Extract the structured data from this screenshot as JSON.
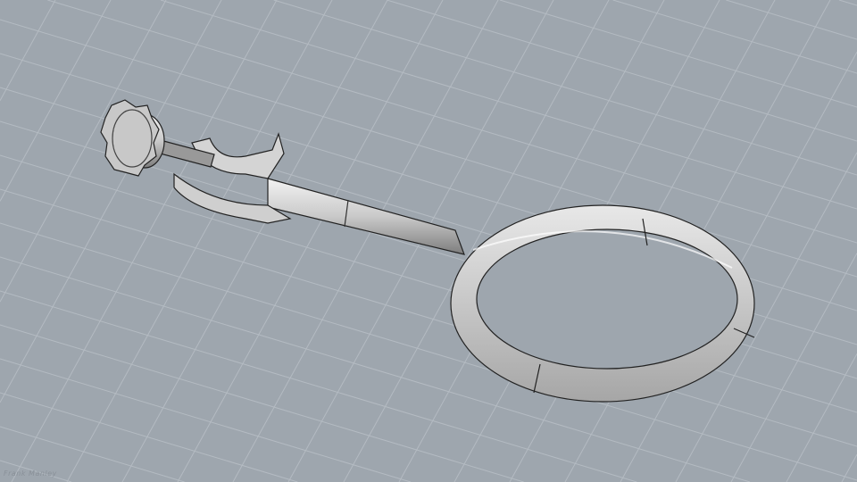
{
  "viewport": {
    "background_color": "#9ea6ae",
    "grid_color": "#b4bbc2",
    "object": "ring-stand-clamp",
    "object_color": "#d9d9d9"
  },
  "signature": "Frank Manley"
}
